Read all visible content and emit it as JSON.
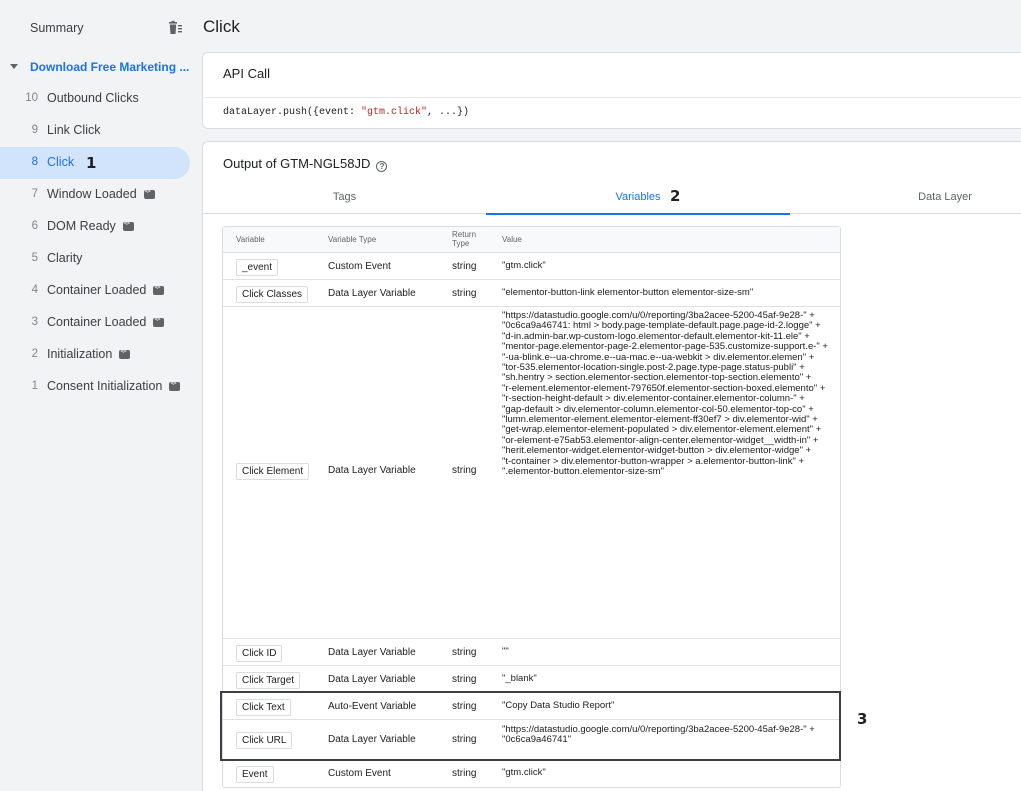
{
  "sidebar": {
    "summary_label": "Summary",
    "container_label": "Download Free Marketing ...",
    "events": [
      {
        "num": "10",
        "name": "Outbound Clicks",
        "code": false,
        "active": false
      },
      {
        "num": "9",
        "name": "Link Click",
        "code": false,
        "active": false
      },
      {
        "num": "8",
        "name": "Click",
        "code": false,
        "active": true
      },
      {
        "num": "7",
        "name": "Window Loaded",
        "code": true,
        "active": false
      },
      {
        "num": "6",
        "name": "DOM Ready",
        "code": true,
        "active": false
      },
      {
        "num": "5",
        "name": "Clarity",
        "code": false,
        "active": false
      },
      {
        "num": "4",
        "name": "Container Loaded",
        "code": true,
        "active": false
      },
      {
        "num": "3",
        "name": "Container Loaded",
        "code": true,
        "active": false
      },
      {
        "num": "2",
        "name": "Initialization",
        "code": true,
        "active": false
      },
      {
        "num": "1",
        "name": "Consent Initialization",
        "code": true,
        "active": false
      }
    ]
  },
  "page_title": "Click",
  "api_call": {
    "title": "API Call",
    "code_prefix": "dataLayer.push({event: ",
    "code_string": "\"gtm.click\"",
    "code_suffix": ", ...})"
  },
  "output": {
    "title": "Output of GTM-NGL58JD",
    "tabs": [
      "Tags",
      "Variables",
      "Data Layer"
    ],
    "active_tab": "Variables"
  },
  "annotations": {
    "a1": "1",
    "a2": "2",
    "a3": "3"
  },
  "table": {
    "headers": {
      "variable": "Variable",
      "type": "Variable Type",
      "return_type": "Return\nType",
      "value": "Value"
    },
    "rows": [
      {
        "name": "_event",
        "type": "Custom Event",
        "ret": "string",
        "value": "\"gtm.click\""
      },
      {
        "name": "Click Classes",
        "type": "Data Layer Variable",
        "ret": "string",
        "value": "\"elementor-button-link elementor-button elementor-size-sm\""
      },
      {
        "name": "Click Element",
        "type": "Data Layer Variable",
        "ret": "string",
        "value": "\"https://datastudio.google.com/u/0/reporting/3ba2acee-5200-45af-9e28-\" +\n\"0c6ca9a46741: html > body.page-template-default.page.page-id-2.logge\" +\n\"d-in.admin-bar.wp-custom-logo.elementor-default.elementor-kit-11.ele\" +\n\"mentor-page.elementor-page-2.elementor-page-535.customize-support.e-\" +\n\"-ua-blink.e--ua-chrome.e--ua-mac.e--ua-webkit > div.elementor.elemen\" +\n\"tor-535.elementor-location-single.post-2.page.type-page.status-publi\" +\n\"sh.hentry > section.elementor-section.elementor-top-section.elemento\" +\n\"r-element.elementor-element-797650f.elementor-section-boxed.elemento\" +\n\"r-section-height-default > div.elementor-container.elementor-column-\" +\n\"gap-default > div.elementor-column.elementor-col-50.elementor-top-co\" +\n\"lumn.elementor-element.elementor-element-ff30ef7 > div.elementor-wid\" +\n\"get-wrap.elementor-element-populated > div.elementor-element.element\" +\n\"or-element-e75ab53.elementor-align-center.elementor-widget__width-in\" +\n\"herit.elementor-widget.elementor-widget-button > div.elementor-widge\" +\n\"t-container > div.elementor-button-wrapper > a.elementor-button-link\" +\n\".elementor-button.elementor-size-sm\""
      },
      {
        "name": "Click ID",
        "type": "Data Layer Variable",
        "ret": "string",
        "value": "\"\""
      },
      {
        "name": "Click Target",
        "type": "Data Layer Variable",
        "ret": "string",
        "value": "\"_blank\""
      },
      {
        "name": "Click Text",
        "type": "Auto-Event Variable",
        "ret": "string",
        "value": "\"Copy Data Studio Report\""
      },
      {
        "name": "Click URL",
        "type": "Data Layer Variable",
        "ret": "string",
        "value": "\"https://datastudio.google.com/u/0/reporting/3ba2acee-5200-45af-9e28-\" +\n\"0c6ca9a46741\""
      },
      {
        "name": "Event",
        "type": "Custom Event",
        "ret": "string",
        "value": "\"gtm.click\""
      }
    ]
  }
}
